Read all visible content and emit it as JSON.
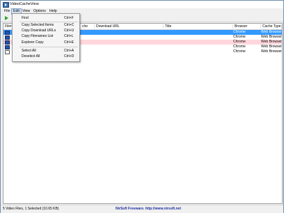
{
  "window": {
    "title": "VideoCacheView"
  },
  "menu": {
    "items": [
      "File",
      "Edit",
      "View",
      "Options",
      "Help"
    ]
  },
  "columns": [
    "Filen",
    "che",
    "Download URL",
    "Title",
    "Browser",
    "Cache Type"
  ],
  "rows": [
    {
      "browser": "Chrome",
      "cache_type": "Web Browser",
      "state": "selected"
    },
    {
      "browser": "Chrome",
      "cache_type": "Web Browser",
      "state": "normal"
    },
    {
      "browser": "Chrome",
      "cache_type": "Web Browser",
      "state": "pink"
    },
    {
      "browser": "Chrome",
      "cache_type": "Web Browser",
      "state": "normal"
    },
    {
      "browser": "Chrome",
      "cache_type": "Web Browser",
      "state": "normal"
    }
  ],
  "edit_menu": [
    {
      "label": "Find",
      "shortcut": "Ctrl+F"
    },
    {
      "label": "Copy Selected Items",
      "shortcut": "Ctrl+C"
    },
    {
      "label": "Copy Download URLs",
      "shortcut": "Ctrl+U"
    },
    {
      "label": "Copy Filenames List",
      "shortcut": "Ctrl+L"
    },
    {
      "label": "Explorer Copy",
      "shortcut": "Ctrl+E"
    },
    {
      "label": "Select All",
      "shortcut": "Ctrl+A"
    },
    {
      "label": "Deselect All",
      "shortcut": "Ctrl+D"
    }
  ],
  "status": {
    "left": "5 Video Files, 1 Selected  (10.65 KB)",
    "center": "NirSoft Freeware.  http://www.nirsoft.net"
  },
  "colors": {
    "selected_row": "#3399ff",
    "pink_row": "#ffd7dc",
    "play_icon": "#24a52a"
  }
}
